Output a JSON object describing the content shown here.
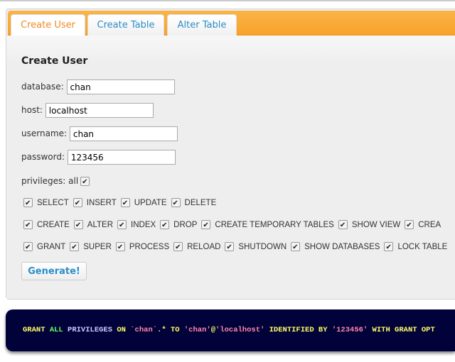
{
  "tabs": [
    {
      "label": "Create User",
      "active": true
    },
    {
      "label": "Create Table",
      "active": false
    },
    {
      "label": "Alter Table",
      "active": false
    }
  ],
  "form": {
    "title": "Create User",
    "database": {
      "label": "database:",
      "value": "chan"
    },
    "host": {
      "label": "host:",
      "value": "localhost"
    },
    "username": {
      "label": "username:",
      "value": "chan"
    },
    "password": {
      "label": "password:",
      "value": "123456"
    },
    "privileges_label": "privileges: all",
    "privilege_rows": [
      [
        "SELECT",
        "INSERT",
        "UPDATE",
        "DELETE"
      ],
      [
        "CREATE",
        "ALTER",
        "INDEX",
        "DROP",
        "CREATE TEMPORARY TABLES",
        "SHOW VIEW",
        "CREA"
      ],
      [
        "GRANT",
        "SUPER",
        "PROCESS",
        "RELOAD",
        "SHUTDOWN",
        "SHOW DATABASES",
        "LOCK TABLE"
      ]
    ],
    "generate_label": "Generate!"
  },
  "output": {
    "tokens": [
      {
        "t": "GRANT ",
        "c": "kw"
      },
      {
        "t": "ALL ",
        "c": "gr"
      },
      {
        "t": "PRIVILEGES ",
        "c": "lb"
      },
      {
        "t": "ON ",
        "c": "kw"
      },
      {
        "t": "`chan`",
        "c": "str"
      },
      {
        "t": ".* TO ",
        "c": "kw"
      },
      {
        "t": "'chan'",
        "c": "str"
      },
      {
        "t": "@",
        "c": "kw"
      },
      {
        "t": "'localhost'",
        "c": "str"
      },
      {
        "t": " IDENTIFIED BY ",
        "c": "kw"
      },
      {
        "t": "'123456'",
        "c": "str"
      },
      {
        "t": " WITH GRANT OPT",
        "c": "kw"
      }
    ]
  },
  "colors": {
    "tab_bar": "#f7a22c",
    "active_tab_text": "#f08a24",
    "tab_text": "#2a8dc8",
    "code_bg": "#02023a"
  }
}
